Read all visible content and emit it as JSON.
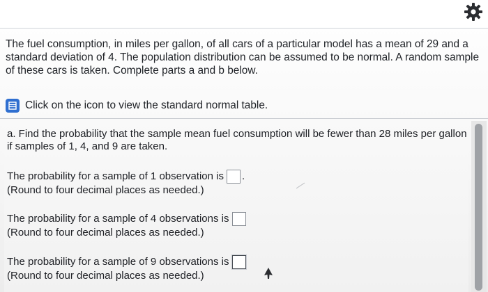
{
  "header": {
    "settings_icon": "gear-icon"
  },
  "problem": {
    "text": "The fuel consumption, in miles per gallon, of all cars of a particular model has a mean of 29 and a standard deviation of 4. The population distribution can be assumed to be normal. A random sample of these cars is taken. Complete parts a and b below."
  },
  "table_link": {
    "icon": "table-icon",
    "label": "Click on the icon to view the standard normal table."
  },
  "part_a": {
    "question": "a. Find the probability that the sample mean fuel consumption will be fewer than 28 miles per gallon if samples of 1, 4, and 9 are taken.",
    "items": [
      {
        "label": "The probability for a sample of 1 observation is",
        "value": "",
        "suffix": ".",
        "hint": "(Round to four decimal places as needed.)"
      },
      {
        "label": "The probability for a sample of 4 observations is",
        "value": "",
        "suffix": "",
        "hint": "(Round to four decimal places as needed.)"
      },
      {
        "label": "The probability for a sample of 9 observations is",
        "value": "",
        "suffix": "",
        "hint": "(Round to four decimal places as needed.)"
      }
    ]
  },
  "colors": {
    "accent": "#2f6fd0",
    "text": "#202328",
    "divider": "#c9cdd2",
    "scroll_thumb": "#9fa2a6"
  }
}
